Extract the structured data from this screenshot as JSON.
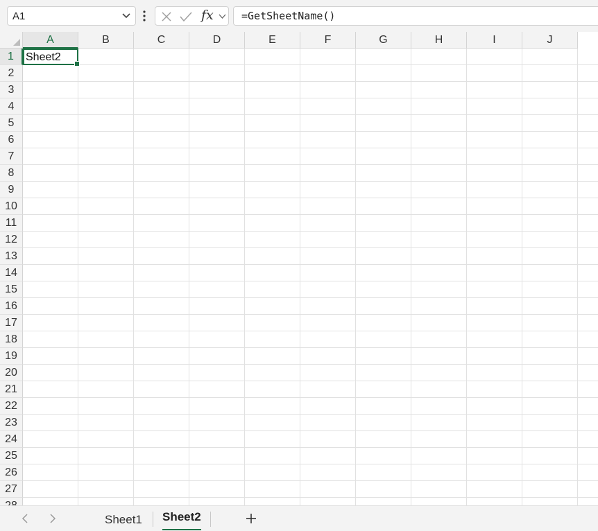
{
  "formula_bar": {
    "name_box": "A1",
    "fx_label": "fx",
    "formula": "=GetSheetName()"
  },
  "grid": {
    "columns": [
      "A",
      "B",
      "C",
      "D",
      "E",
      "F",
      "G",
      "H",
      "I",
      "J"
    ],
    "rows": [
      "1",
      "2",
      "3",
      "4",
      "5",
      "6",
      "7",
      "8",
      "9",
      "10",
      "11",
      "12",
      "13",
      "14",
      "15",
      "16",
      "17",
      "18",
      "19",
      "20",
      "21",
      "22",
      "23",
      "24",
      "25",
      "26",
      "27",
      "28"
    ],
    "selected_cell": "A1",
    "cell_a1_value": "Sheet2"
  },
  "sheet_tabs": {
    "tabs": [
      "Sheet1",
      "Sheet2"
    ],
    "active": "Sheet2"
  },
  "colors": {
    "accent": "#1e7145",
    "gridline": "#e1e1e1",
    "header_bg": "#f3f3f3"
  }
}
